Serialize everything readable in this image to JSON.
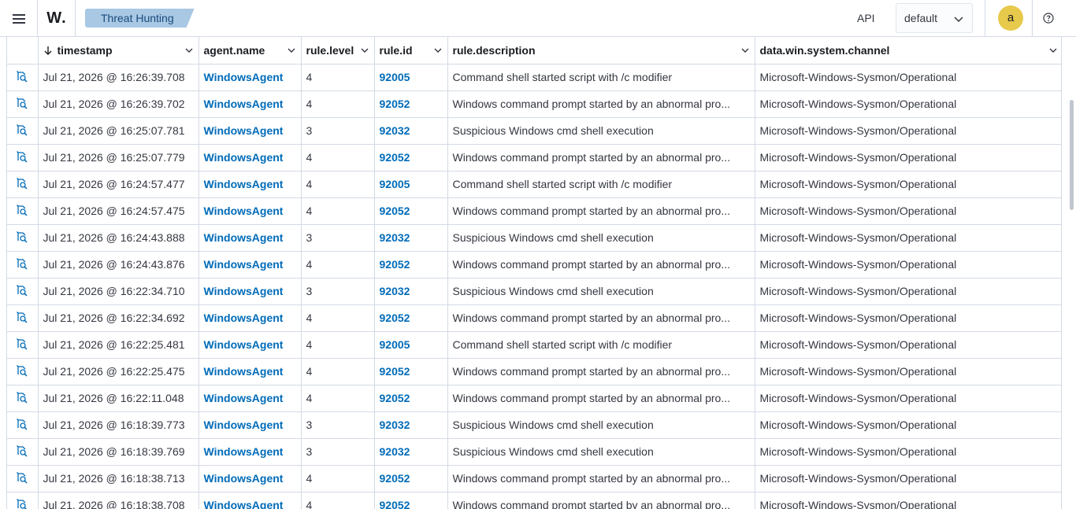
{
  "header": {
    "logo_text": "W",
    "logo_dot": ".",
    "breadcrumb": "Threat Hunting",
    "api_label": "API",
    "tenant_value": "default",
    "avatar_letter": "a",
    "accent_color": "#006bb8",
    "avatar_color": "#e7c94c",
    "breadcrumb_color": "#a8c8e4"
  },
  "icons": {
    "menu": "hamburger-menu-icon",
    "chevron": "chevron-down-icon",
    "help": "help-icon",
    "inspect": "inspect-document-icon",
    "sort": "sort-descending-icon"
  },
  "table": {
    "columns": [
      {
        "label": "timestamp",
        "sorted": "desc"
      },
      {
        "label": "agent.name"
      },
      {
        "label": "rule.level"
      },
      {
        "label": "rule.id"
      },
      {
        "label": "rule.description"
      },
      {
        "label": "data.win.system.channel"
      }
    ],
    "rows": [
      {
        "timestamp": "Jul 21, 2026 @ 16:26:39.708",
        "agent": "WindowsAgent",
        "level": "4",
        "rule_id": "92005",
        "description": "Command shell started script with /c modifier",
        "channel": "Microsoft-Windows-Sysmon/Operational"
      },
      {
        "timestamp": "Jul 21, 2026 @ 16:26:39.702",
        "agent": "WindowsAgent",
        "level": "4",
        "rule_id": "92052",
        "description": "Windows command prompt started by an abnormal pro...",
        "channel": "Microsoft-Windows-Sysmon/Operational"
      },
      {
        "timestamp": "Jul 21, 2026 @ 16:25:07.781",
        "agent": "WindowsAgent",
        "level": "3",
        "rule_id": "92032",
        "description": "Suspicious Windows cmd shell execution",
        "channel": "Microsoft-Windows-Sysmon/Operational"
      },
      {
        "timestamp": "Jul 21, 2026 @ 16:25:07.779",
        "agent": "WindowsAgent",
        "level": "4",
        "rule_id": "92052",
        "description": "Windows command prompt started by an abnormal pro...",
        "channel": "Microsoft-Windows-Sysmon/Operational"
      },
      {
        "timestamp": "Jul 21, 2026 @ 16:24:57.477",
        "agent": "WindowsAgent",
        "level": "4",
        "rule_id": "92005",
        "description": "Command shell started script with /c modifier",
        "channel": "Microsoft-Windows-Sysmon/Operational"
      },
      {
        "timestamp": "Jul 21, 2026 @ 16:24:57.475",
        "agent": "WindowsAgent",
        "level": "4",
        "rule_id": "92052",
        "description": "Windows command prompt started by an abnormal pro...",
        "channel": "Microsoft-Windows-Sysmon/Operational"
      },
      {
        "timestamp": "Jul 21, 2026 @ 16:24:43.888",
        "agent": "WindowsAgent",
        "level": "3",
        "rule_id": "92032",
        "description": "Suspicious Windows cmd shell execution",
        "channel": "Microsoft-Windows-Sysmon/Operational"
      },
      {
        "timestamp": "Jul 21, 2026 @ 16:24:43.876",
        "agent": "WindowsAgent",
        "level": "4",
        "rule_id": "92052",
        "description": "Windows command prompt started by an abnormal pro...",
        "channel": "Microsoft-Windows-Sysmon/Operational"
      },
      {
        "timestamp": "Jul 21, 2026 @ 16:22:34.710",
        "agent": "WindowsAgent",
        "level": "3",
        "rule_id": "92032",
        "description": "Suspicious Windows cmd shell execution",
        "channel": "Microsoft-Windows-Sysmon/Operational"
      },
      {
        "timestamp": "Jul 21, 2026 @ 16:22:34.692",
        "agent": "WindowsAgent",
        "level": "4",
        "rule_id": "92052",
        "description": "Windows command prompt started by an abnormal pro...",
        "channel": "Microsoft-Windows-Sysmon/Operational"
      },
      {
        "timestamp": "Jul 21, 2026 @ 16:22:25.481",
        "agent": "WindowsAgent",
        "level": "4",
        "rule_id": "92005",
        "description": "Command shell started script with /c modifier",
        "channel": "Microsoft-Windows-Sysmon/Operational"
      },
      {
        "timestamp": "Jul 21, 2026 @ 16:22:25.475",
        "agent": "WindowsAgent",
        "level": "4",
        "rule_id": "92052",
        "description": "Windows command prompt started by an abnormal pro...",
        "channel": "Microsoft-Windows-Sysmon/Operational"
      },
      {
        "timestamp": "Jul 21, 2026 @ 16:22:11.048",
        "agent": "WindowsAgent",
        "level": "4",
        "rule_id": "92052",
        "description": "Windows command prompt started by an abnormal pro...",
        "channel": "Microsoft-Windows-Sysmon/Operational"
      },
      {
        "timestamp": "Jul 21, 2026 @ 16:18:39.773",
        "agent": "WindowsAgent",
        "level": "3",
        "rule_id": "92032",
        "description": "Suspicious Windows cmd shell execution",
        "channel": "Microsoft-Windows-Sysmon/Operational"
      },
      {
        "timestamp": "Jul 21, 2026 @ 16:18:39.769",
        "agent": "WindowsAgent",
        "level": "3",
        "rule_id": "92032",
        "description": "Suspicious Windows cmd shell execution",
        "channel": "Microsoft-Windows-Sysmon/Operational"
      },
      {
        "timestamp": "Jul 21, 2026 @ 16:18:38.713",
        "agent": "WindowsAgent",
        "level": "4",
        "rule_id": "92052",
        "description": "Windows command prompt started by an abnormal pro...",
        "channel": "Microsoft-Windows-Sysmon/Operational"
      },
      {
        "timestamp": "Jul 21, 2026 @ 16:18:38.708",
        "agent": "WindowsAgent",
        "level": "4",
        "rule_id": "92052",
        "description": "Windows command prompt started by an abnormal pro...",
        "channel": "Microsoft-Windows-Sysmon/Operational"
      }
    ]
  }
}
